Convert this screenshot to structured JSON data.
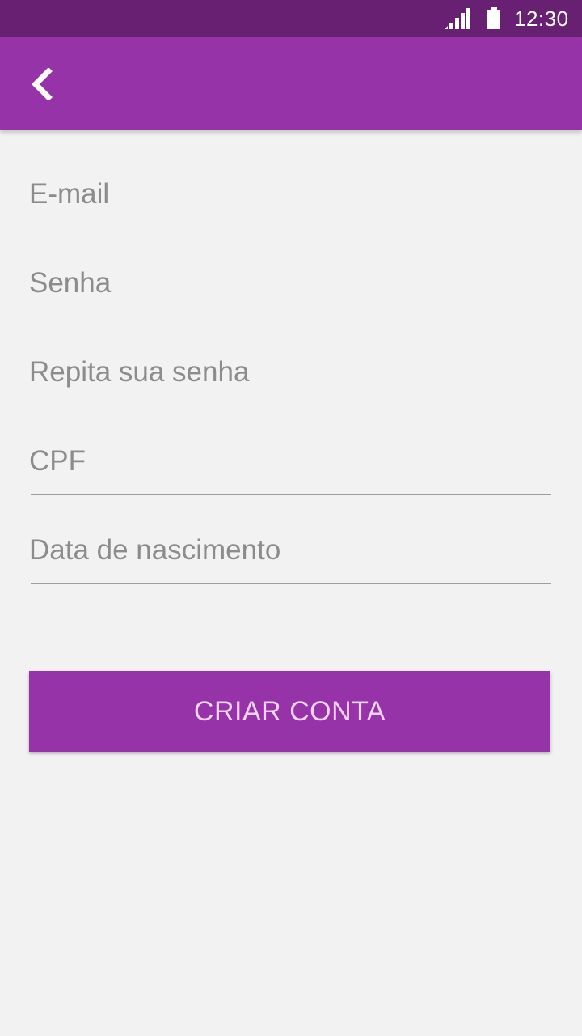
{
  "status_bar": {
    "time": "12:30",
    "icons": [
      "signal-icon",
      "battery-icon"
    ]
  },
  "app_bar": {
    "back_icon": "chevron-left-icon"
  },
  "form": {
    "email_placeholder": "E-mail",
    "password_placeholder": "Senha",
    "repeat_password_placeholder": "Repita sua senha",
    "cpf_placeholder": "CPF",
    "birthdate_placeholder": "Data de nascimento"
  },
  "actions": {
    "create_account_label": "CRIAR CONTA"
  },
  "colors": {
    "status_bar": "#682072",
    "primary": "#9633a8",
    "background": "#f2f2f2",
    "button_text": "#f1d4f4"
  }
}
